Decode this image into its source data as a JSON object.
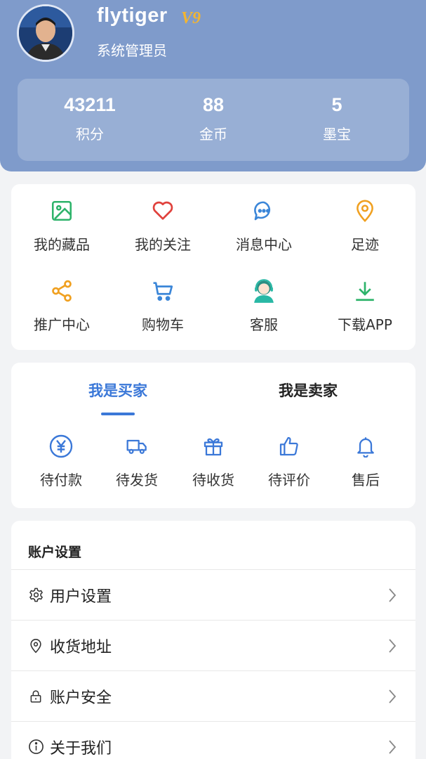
{
  "profile": {
    "username": "flytiger",
    "vip_level": "V9",
    "role": "系统管理员"
  },
  "stats": [
    {
      "value": "43211",
      "label": "积分"
    },
    {
      "value": "88",
      "label": "金币"
    },
    {
      "value": "5",
      "label": "墨宝"
    }
  ],
  "shortcuts": [
    {
      "label": "我的藏品",
      "icon": "image-icon",
      "color": "#2db36a"
    },
    {
      "label": "我的关注",
      "icon": "heart-icon",
      "color": "#e0413c"
    },
    {
      "label": "消息中心",
      "icon": "chat-icon",
      "color": "#3b86d8"
    },
    {
      "label": "足迹",
      "icon": "location-pin-icon",
      "color": "#f0a020"
    },
    {
      "label": "推广中心",
      "icon": "share-icon",
      "color": "#f0a020"
    },
    {
      "label": "购物车",
      "icon": "cart-icon",
      "color": "#3b86d8"
    },
    {
      "label": "客服",
      "icon": "customer-service-icon",
      "color": "#29b8a5"
    },
    {
      "label": "下载APP",
      "icon": "download-icon",
      "color": "#2db36a"
    }
  ],
  "order_tabs": {
    "buyer": "我是买家",
    "seller": "我是卖家",
    "active": "buyer"
  },
  "order_status": [
    {
      "label": "待付款",
      "icon": "yen-icon"
    },
    {
      "label": "待发货",
      "icon": "truck-icon"
    },
    {
      "label": "待收货",
      "icon": "gift-icon"
    },
    {
      "label": "待评价",
      "icon": "thumbs-up-icon"
    },
    {
      "label": "售后",
      "icon": "bell-icon"
    }
  ],
  "account": {
    "title": "账户设置",
    "items": [
      {
        "label": "用户设置",
        "icon": "gear-icon"
      },
      {
        "label": "收货地址",
        "icon": "location-pin-icon"
      },
      {
        "label": "账户安全",
        "icon": "lock-icon"
      },
      {
        "label": "关于我们",
        "icon": "info-icon"
      }
    ]
  },
  "colors": {
    "header_bg": "#7f9bcb",
    "accent": "#3b78d8",
    "vip": "#f3b531"
  }
}
